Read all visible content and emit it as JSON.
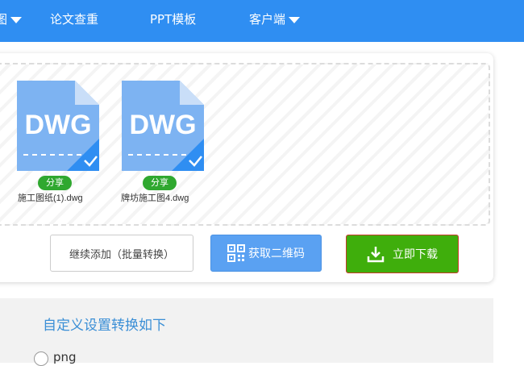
{
  "nav": {
    "items": [
      {
        "label": "图",
        "has_caret": true
      },
      {
        "label": "论文查重",
        "has_caret": false
      },
      {
        "label": "PPT模板",
        "has_caret": false
      },
      {
        "label": "客户端",
        "has_caret": true
      }
    ],
    "background": "#2f8ef2"
  },
  "files": [
    {
      "icon_text": "DWG",
      "badge": "分享",
      "name": "施工图纸(1).dwg",
      "icon": "dwg-file-icon",
      "checked": true
    },
    {
      "icon_text": "DWG",
      "badge": "分享",
      "name": "牌坊施工图4.dwg",
      "icon": "dwg-file-icon",
      "checked": true
    }
  ],
  "actions": {
    "continue_label": "继续添加（批量转换）",
    "qr_label": "获取二维码",
    "download_label": "立即下载"
  },
  "settings": {
    "title": "自定义设置转换如下",
    "option_label": "png"
  },
  "colors": {
    "accent": "#2f8ef2",
    "file_icon": "#7db3f2",
    "badge_green": "#2fa82f",
    "download_green": "#3fae0c",
    "qr_blue": "#5aa1f2",
    "settings_title": "#3b8fd6"
  }
}
